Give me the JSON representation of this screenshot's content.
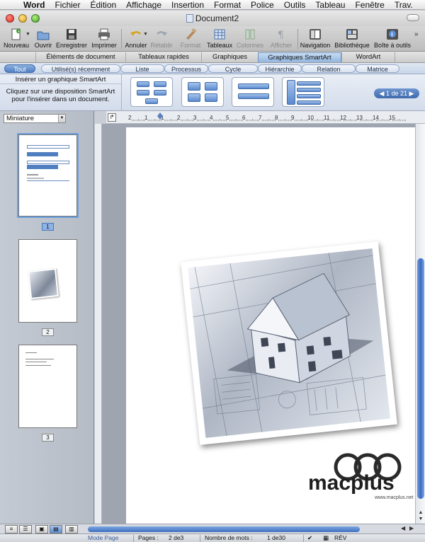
{
  "menubar": {
    "app": "Word",
    "items": [
      "Fichier",
      "Édition",
      "Affichage",
      "Insertion",
      "Format",
      "Police",
      "Outils",
      "Tableau",
      "Fenêtre",
      "Trav."
    ]
  },
  "window": {
    "title": "Document2"
  },
  "toolbar": {
    "new": "Nouveau",
    "open": "Ouvrir",
    "save": "Enregistrer",
    "print": "Imprimer",
    "undo": "Annuler",
    "redo": "Rétablir",
    "format": "Format",
    "tables": "Tableaux",
    "columns": "Colonnes",
    "show": "Afficher",
    "navigation": "Navigation",
    "library": "Bibliothèque",
    "toolbox": "Boîte à outils"
  },
  "elements_tabs": [
    "Éléments de document",
    "Tableaux rapides",
    "Graphiques",
    "Graphiques SmartArt",
    "WordArt"
  ],
  "categories": [
    "Tout",
    "Utilisé(s) récemment",
    "Liste",
    "Processus",
    "Cycle",
    "Hiérarchie",
    "Relation",
    "Matrice"
  ],
  "gallery": {
    "heading": "Insérer un graphique SmartArt",
    "hint_line1": "Cliquez sur une disposition SmartArt",
    "hint_line2": "pour l'insérer dans un document.",
    "pager": "1 de 21"
  },
  "sidebar": {
    "view_select": "Miniature",
    "pages": [
      "1",
      "2",
      "3"
    ]
  },
  "ruler_ticks": [
    "2",
    "1",
    "1",
    "2",
    "3",
    "4",
    "5",
    "6",
    "7",
    "8",
    "9",
    "10",
    "11",
    "12",
    "13",
    "14",
    "15"
  ],
  "watermark": {
    "logo": "macplus",
    "url": "www.macplus.net"
  },
  "status": {
    "mode": "Mode Page",
    "pages_label": "Pages :",
    "pages_value": "2 de3",
    "words_label": "Nombre de mots :",
    "words_value": "1 de30",
    "rev": "RÉV"
  },
  "colors": {
    "accent": "#4f7fc0",
    "selection": "#8db3e6"
  }
}
